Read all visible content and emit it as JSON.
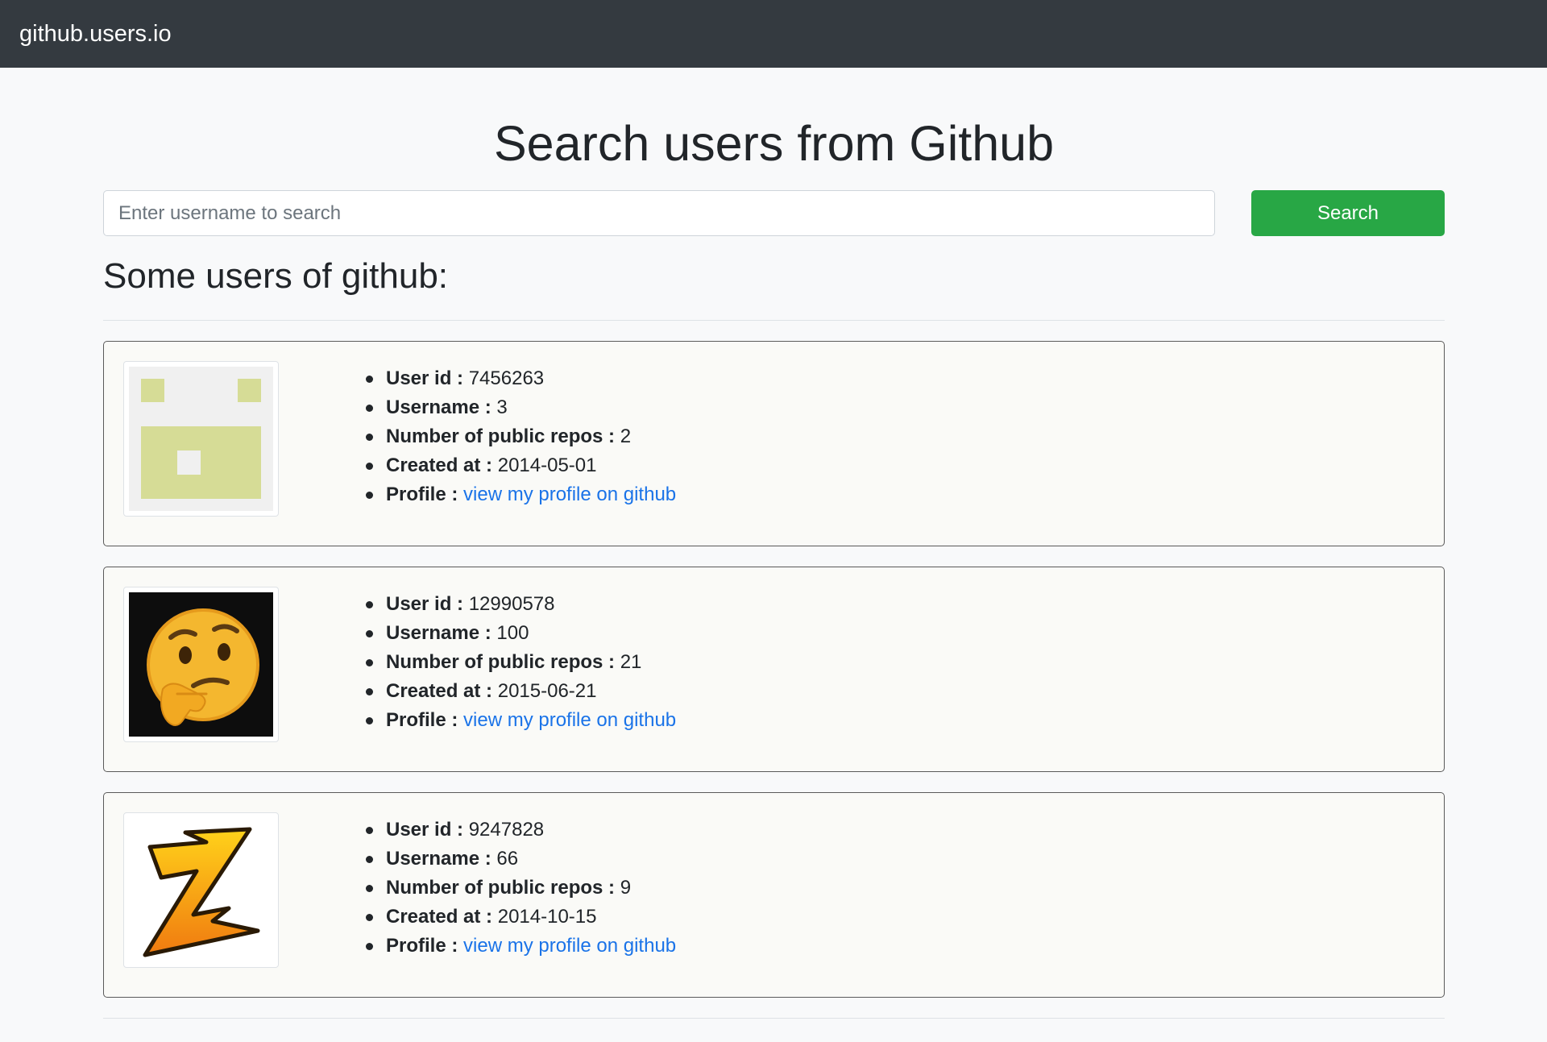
{
  "navbar": {
    "brand": "github.users.io"
  },
  "page": {
    "heading": "Search users from Github",
    "subheading": "Some users of github:"
  },
  "search": {
    "placeholder": "Enter username to search",
    "value": "",
    "button_label": "Search"
  },
  "labels": {
    "user_id": "User id :",
    "username": "Username :",
    "repos": "Number of public repos :",
    "created": "Created at :",
    "profile": "Profile :"
  },
  "users": [
    {
      "user_id": "7456263",
      "username": "3",
      "repos": "2",
      "created_at": "2014-05-01",
      "profile_link_text": "view my profile on github",
      "avatar_icon": "pixel-identicon-icon",
      "avatar_color": "#d6dc96"
    },
    {
      "user_id": "12990578",
      "username": "100",
      "repos": "21",
      "created_at": "2015-06-21",
      "profile_link_text": "view my profile on github",
      "avatar_icon": "thinking-face-emoji-icon",
      "avatar_color": "#f4b72f"
    },
    {
      "user_id": "9247828",
      "username": "66",
      "repos": "9",
      "created_at": "2014-10-15",
      "profile_link_text": "view my profile on github",
      "avatar_icon": "lightning-z-logo-icon",
      "avatar_color": "#f7a317"
    }
  ]
}
